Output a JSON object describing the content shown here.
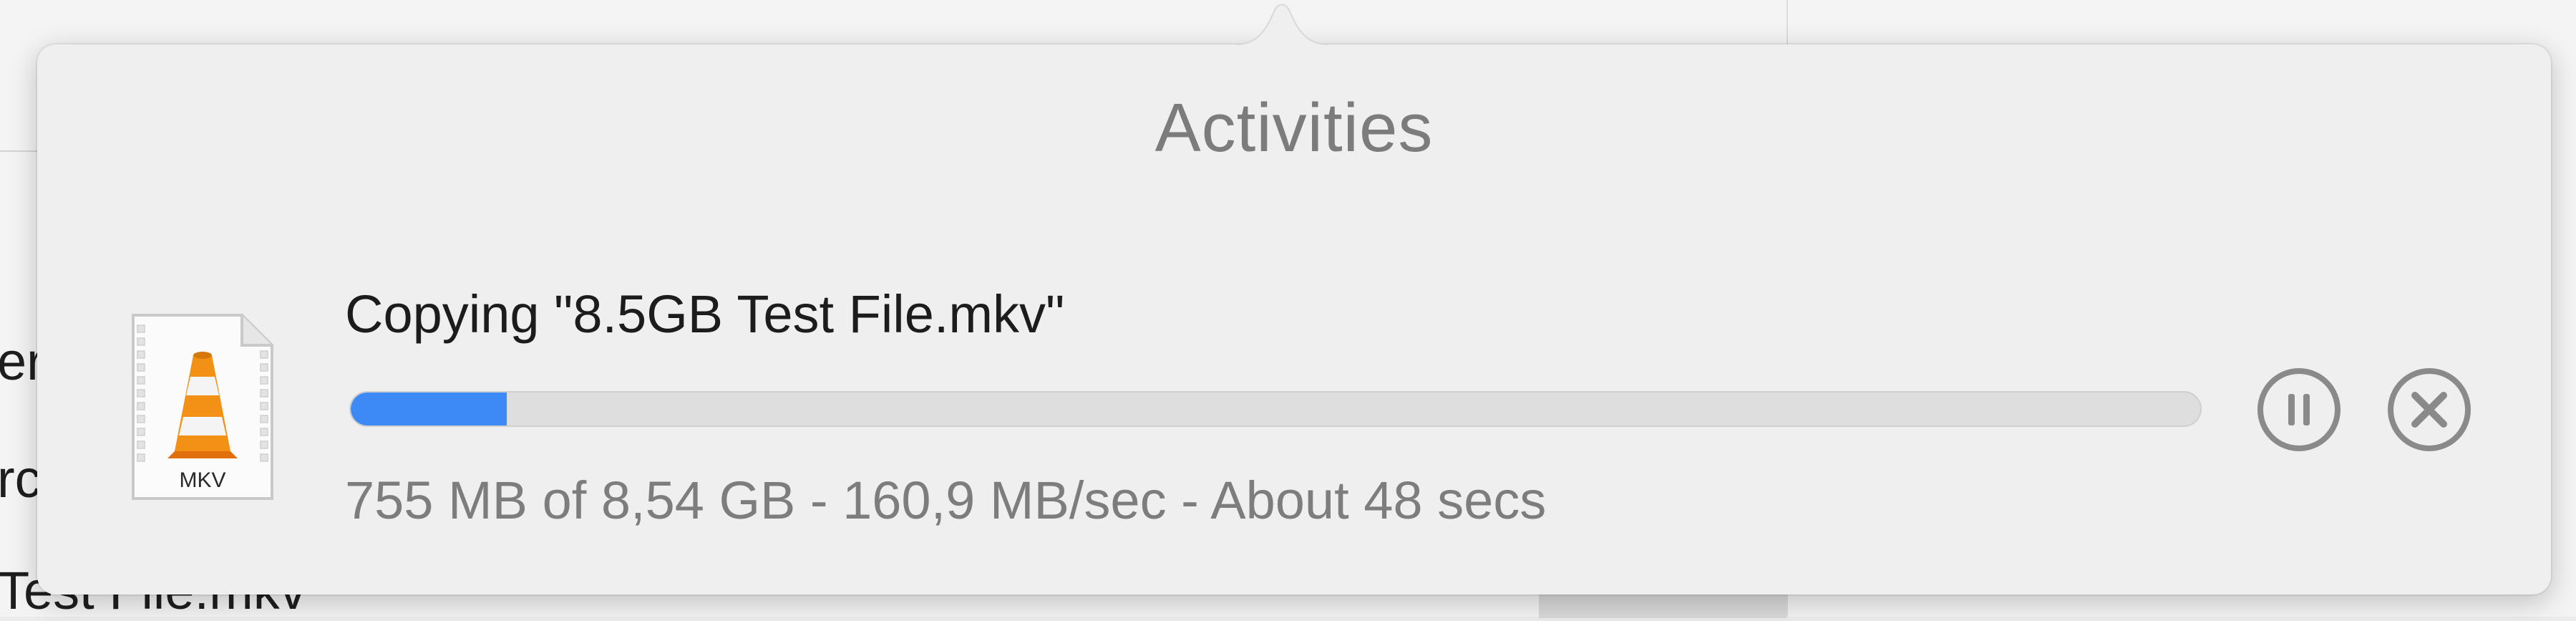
{
  "background": {
    "partial_text_lines": [
      "er",
      "rc",
      "Test File.mkv"
    ]
  },
  "popover": {
    "title": "Activities"
  },
  "activity": {
    "file_icon": "mkv-file-icon",
    "file_icon_label": "MKV",
    "title": "Copying \"8.5GB Test File.mkv\"",
    "progress": 0.0845,
    "status": "755 MB of 8,54 GB - 160,9 MB/sec - About 48 secs",
    "pause_icon": "pause-circle-icon",
    "cancel_icon": "x-circle-icon"
  },
  "colors": {
    "progress_fill": "#3d8af7",
    "progress_track": "#dedede",
    "title_gray": "#7c7c7c",
    "icon_gray": "#8a8a8a"
  }
}
